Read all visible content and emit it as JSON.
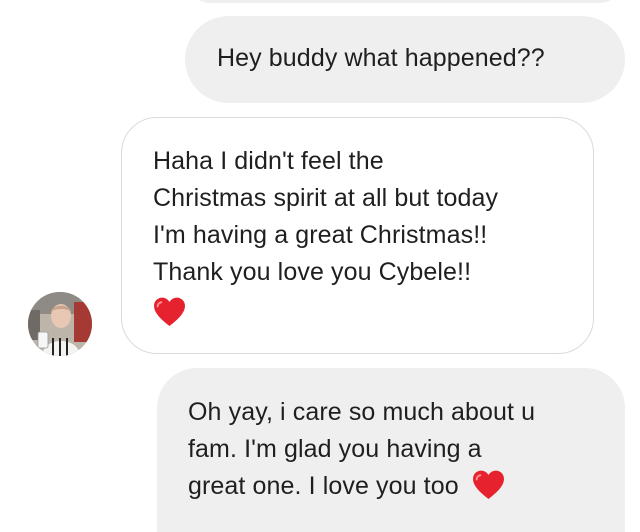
{
  "thread": {
    "messages": [
      {
        "sender": "me",
        "lines": [
          "Hey buddy what happened??"
        ]
      },
      {
        "sender": "them",
        "lines": [
          "Haha I didn't feel the",
          "Christmas spirit at all but today",
          "I'm having a great Christmas!!",
          "Thank you love you Cybele!!"
        ],
        "trailing_icon": "red-heart-emoji"
      },
      {
        "sender": "me",
        "lines": [
          "Oh yay, i care so much about u",
          "fam. I'm glad you having a",
          "great one. I love you too"
        ],
        "trailing_icon": "red-heart-emoji"
      }
    ]
  },
  "colors": {
    "outgoing_bubble": "#efefef",
    "incoming_border": "#dbdbdb",
    "heart": "#e5222e",
    "text": "#1f1f1f"
  }
}
